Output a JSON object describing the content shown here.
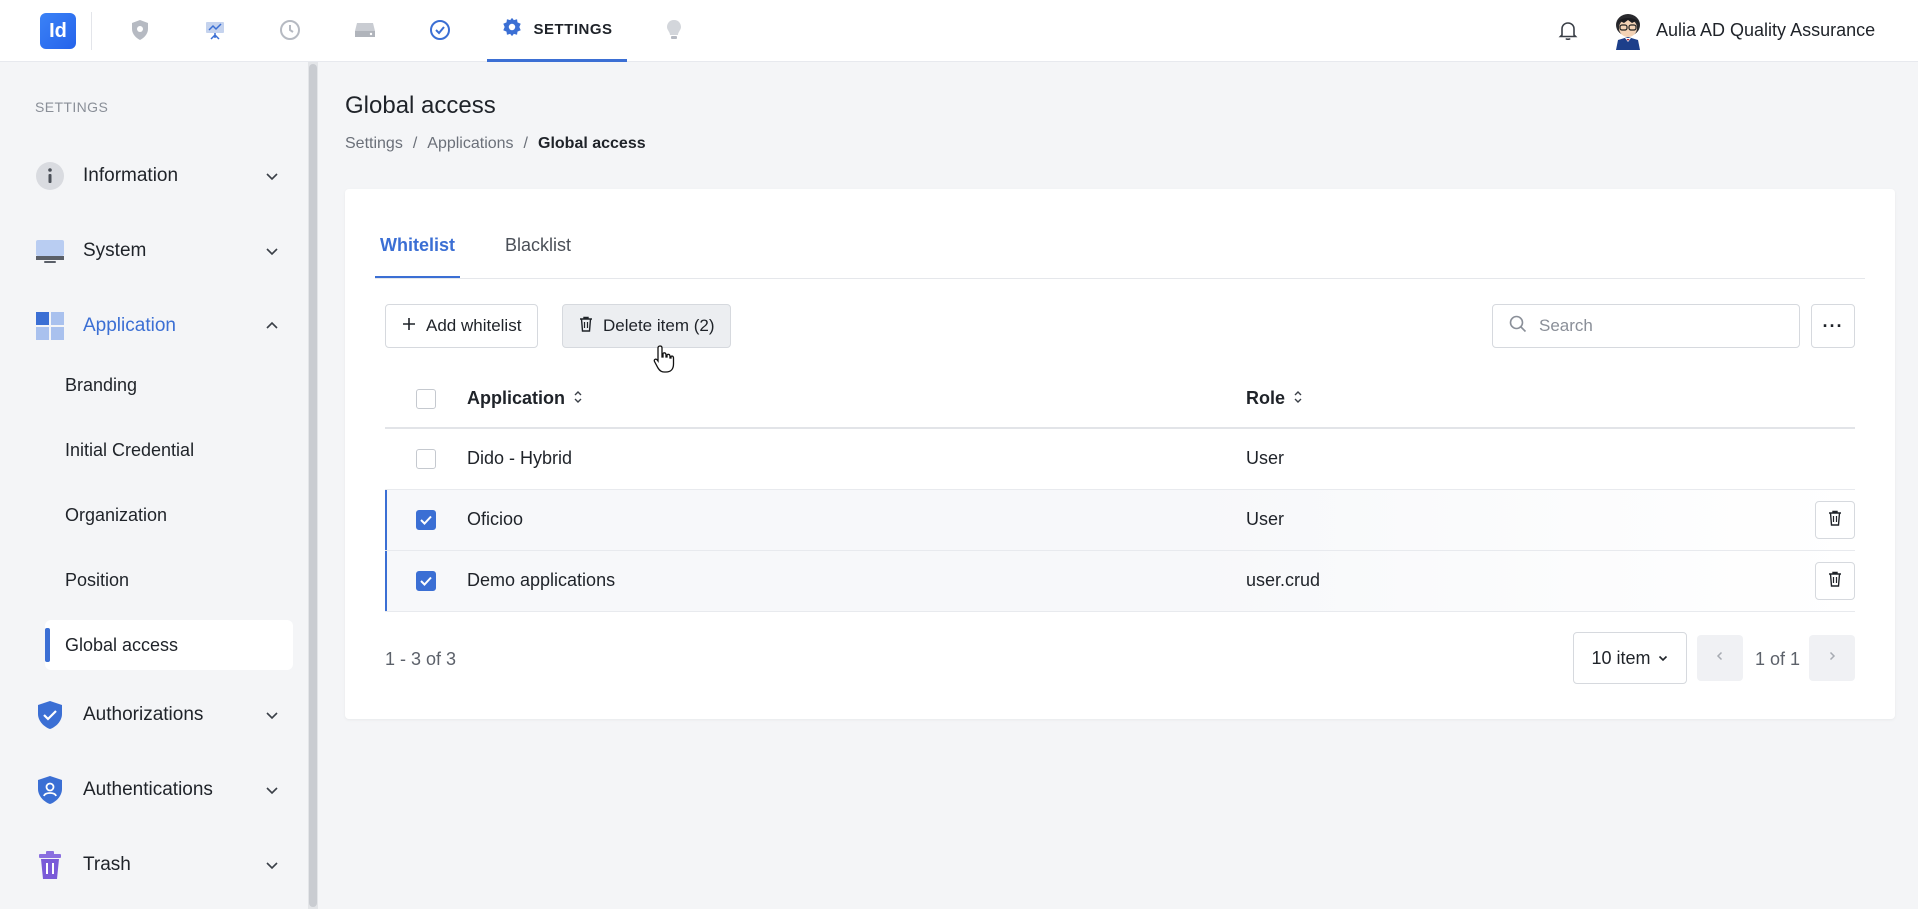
{
  "topbar": {
    "logo_text": "Id",
    "active_nav_label": "SETTINGS",
    "user_name": "Aulia AD Quality Assurance",
    "nav_icons": [
      "shield-icon",
      "presentation-icon",
      "history-icon",
      "drive-icon",
      "check-circle-icon",
      "gear-icon",
      "bulb-icon"
    ]
  },
  "sidebar": {
    "section_title": "SETTINGS",
    "items": [
      {
        "label": "Information",
        "icon": "info-icon"
      },
      {
        "label": "System",
        "icon": "monitor-icon"
      },
      {
        "label": "Application",
        "icon": "grid-icon"
      },
      {
        "label": "Authorizations",
        "icon": "shield-check-icon"
      },
      {
        "label": "Authentications",
        "icon": "shield-user-icon"
      },
      {
        "label": "Trash",
        "icon": "trash-icon"
      }
    ],
    "subitems": [
      "Branding",
      "Initial Credential",
      "Organization",
      "Position",
      "Global access"
    ]
  },
  "page": {
    "title": "Global access",
    "breadcrumb": [
      "Settings",
      "Applications",
      "Global access"
    ],
    "breadcrumb_sep": "/"
  },
  "tabs": [
    "Whitelist",
    "Blacklist"
  ],
  "toolbar": {
    "add_label": "Add whitelist",
    "delete_label": "Delete item (2)",
    "search_placeholder": "Search",
    "more_label": "···"
  },
  "table": {
    "headers": [
      "Application",
      "Role"
    ],
    "rows": [
      {
        "application": "Dido - Hybrid",
        "role": "User",
        "checked": false
      },
      {
        "application": "Oficioo",
        "role": "User",
        "checked": true
      },
      {
        "application": "Demo applications",
        "role": "user.crud",
        "checked": true
      }
    ]
  },
  "pagination": {
    "count_text": "1 - 3 of 3",
    "per_page": "10 item",
    "page_text": "1 of 1"
  },
  "colors": {
    "accent": "#3b6fd4"
  }
}
